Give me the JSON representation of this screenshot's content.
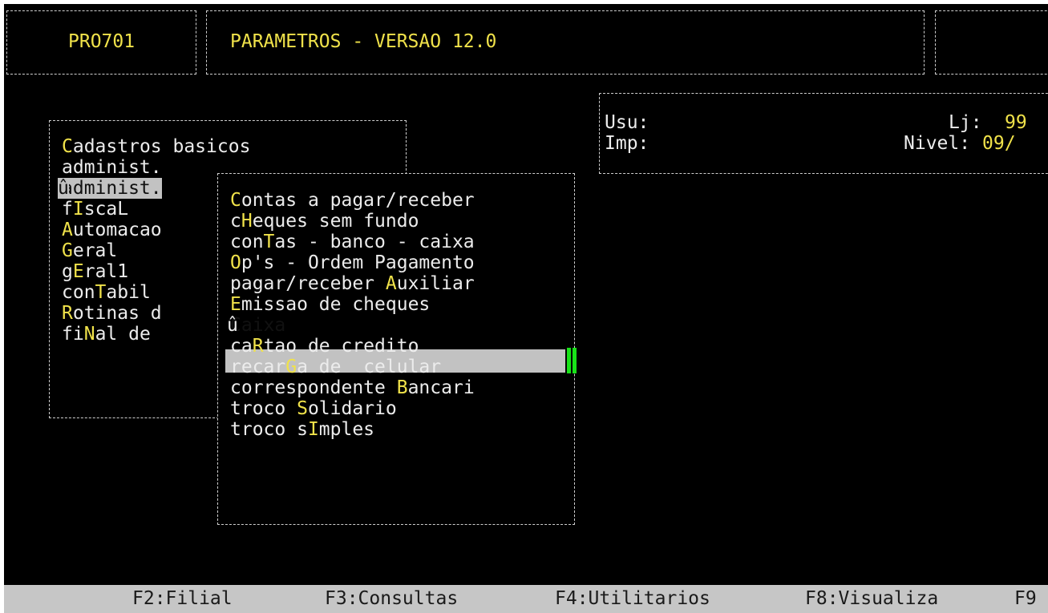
{
  "header": {
    "program_code": "PRO701",
    "title": "PARAMETROS - VERSAO 12.0"
  },
  "info_panel": {
    "user_label": "Usu:",
    "printer_label": "Imp:",
    "store_label": "Lj:",
    "store_value": "99",
    "level_label": "Nivel:",
    "level_value": "09/"
  },
  "main_menu": {
    "items": [
      {
        "pre": "",
        "hot": "C",
        "post": "adastros basicos"
      },
      {
        "pre": "administ.",
        "hot": "",
        "post": ""
      },
      {
        "pre": "administ.",
        "hot": "",
        "post": "",
        "marker": "û",
        "selected": true
      },
      {
        "pre": "f",
        "hot": "I",
        "post": "scaL"
      },
      {
        "pre": "",
        "hot": "A",
        "post": "utomacao"
      },
      {
        "pre": "",
        "hot": "G",
        "post": "eral"
      },
      {
        "pre": "g",
        "hot": "E",
        "post": "ral1"
      },
      {
        "pre": "con",
        "hot": "T",
        "post": "abil"
      },
      {
        "pre": "",
        "hot": "R",
        "post": "otinas d"
      },
      {
        "pre": "fi",
        "hot": "N",
        "post": "al de"
      }
    ]
  },
  "submenu": {
    "items": [
      {
        "pre": "",
        "hot": "C",
        "post": "ontas a pagar/receber"
      },
      {
        "pre": "c",
        "hot": "H",
        "post": "eques sem fundo"
      },
      {
        "pre": "con",
        "hot": "T",
        "post": "as - banco - caixa"
      },
      {
        "pre": "",
        "hot": "O",
        "post": "p's - Ordem Pagamento"
      },
      {
        "pre": "pagar/receber ",
        "hot": "A",
        "post": "uxiliar"
      },
      {
        "pre": "",
        "hot": "E",
        "post": "missao de cheques"
      },
      {
        "pre": "Caixa",
        "hot": "",
        "post": "",
        "marker": "û",
        "selected": true
      },
      {
        "pre": "ca",
        "hot": "R",
        "post": "tao de credito"
      },
      {
        "pre": "recar",
        "hot": "G",
        "post": "a de  celular"
      },
      {
        "pre": "correspondente ",
        "hot": "B",
        "post": "ancari"
      },
      {
        "pre": "troco ",
        "hot": "S",
        "post": "olidario"
      },
      {
        "pre": "troco s",
        "hot": "I",
        "post": "mples"
      }
    ]
  },
  "function_keys": [
    {
      "label": "F2:Filial"
    },
    {
      "label": "F3:Consultas"
    },
    {
      "label": "F4:Utilitarios"
    },
    {
      "label": "F8:Visualiza"
    },
    {
      "label": "F9"
    }
  ]
}
